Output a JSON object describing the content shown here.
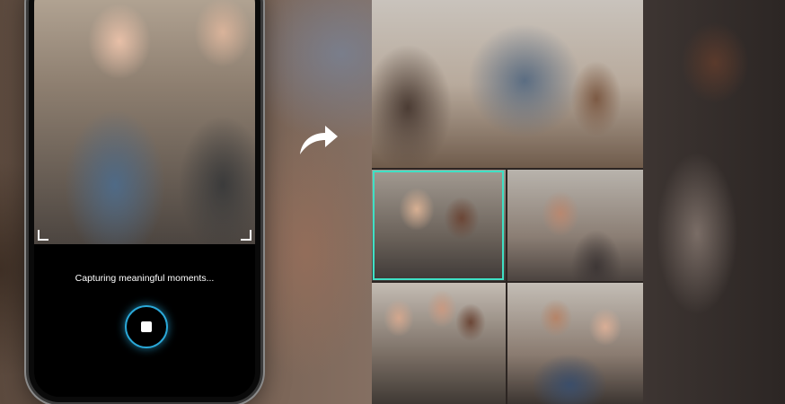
{
  "camera": {
    "status_text": "Capturing meaningful moments...",
    "shutter_icon": "stop-icon"
  },
  "transition": {
    "arrow_icon": "curved-arrow-icon"
  },
  "collage": {
    "highlight_color": "#3fe0c5",
    "tiles": [
      "top",
      "middle-left",
      "middle-right",
      "bottom-left",
      "bottom-right"
    ]
  },
  "colors": {
    "shutter_ring": "#2aa8d8",
    "highlight": "#3fe0c5"
  }
}
